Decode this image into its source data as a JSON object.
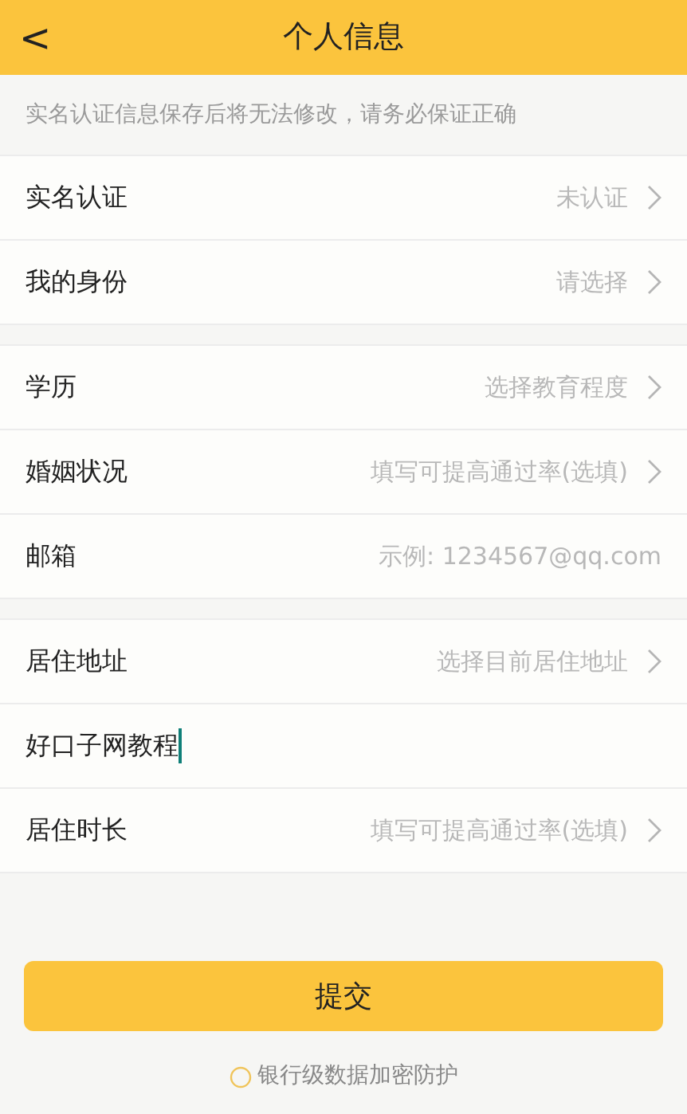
{
  "header": {
    "back": "<",
    "title": "个人信息"
  },
  "notice": "实名认证信息保存后将无法修改，请务必保证正确",
  "groups": [
    {
      "rows": [
        {
          "kind": "select",
          "label": "实名认证",
          "hint": "未认证"
        },
        {
          "kind": "select",
          "label": "我的身份",
          "hint": "请选择"
        }
      ]
    },
    {
      "rows": [
        {
          "kind": "select",
          "label": "学历",
          "hint": "选择教育程度"
        },
        {
          "kind": "select",
          "label": "婚姻状况",
          "hint": "填写可提高通过率(选填)"
        },
        {
          "kind": "field",
          "label": "邮箱",
          "placeholder": "示例: 1234567@qq.com"
        }
      ]
    },
    {
      "rows": [
        {
          "kind": "select",
          "label": "居住地址",
          "hint": "选择目前居住地址"
        },
        {
          "kind": "text",
          "value": "好口子网教程",
          "focused": true
        },
        {
          "kind": "select",
          "label": "居住时长",
          "hint": "填写可提高通过率(选填)"
        }
      ]
    }
  ],
  "submit": "提交",
  "footer": "银行级数据加密防护"
}
